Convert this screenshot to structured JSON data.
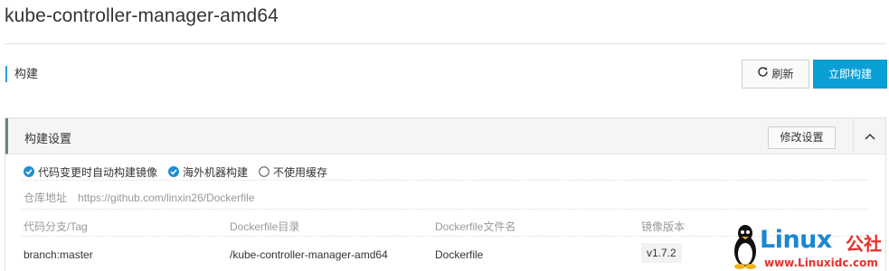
{
  "page": {
    "title": "kube-controller-manager-amd64"
  },
  "section": {
    "label": "构建"
  },
  "toolbar": {
    "refresh_label": "刷新",
    "build_now_label": "立即构建"
  },
  "panel": {
    "title": "构建设置",
    "edit_label": "修改设置",
    "options": [
      {
        "label": "代码变更时自动构建镜像",
        "checked": true
      },
      {
        "label": "海外机器构建",
        "checked": true
      },
      {
        "label": "不使用缓存",
        "checked": false
      }
    ],
    "repo_label": "仓库地址",
    "repo_url": "https://github.com/linxin26/Dockerfile",
    "columns": [
      "代码分支/Tag",
      "Dockerfile目录",
      "Dockerfile文件名",
      "镜像版本"
    ],
    "rows": [
      {
        "branch": "branch:master",
        "dir": "/kube-controller-manager-amd64",
        "file": "Dockerfile",
        "version": "v1.7.2"
      }
    ]
  },
  "watermark": {
    "brand": "Linux",
    "cn": "公社",
    "url": "www.Linuxidc.com"
  },
  "colors": {
    "accent": "#0aa0d6",
    "watermark_blue": "#1b88d0",
    "watermark_red": "#e4312a"
  },
  "icons": {
    "refresh": "refresh-icon",
    "collapse": "chevron-up-icon",
    "checked": "checkbox-checked-icon",
    "unchecked": "radio-unchecked-icon"
  }
}
